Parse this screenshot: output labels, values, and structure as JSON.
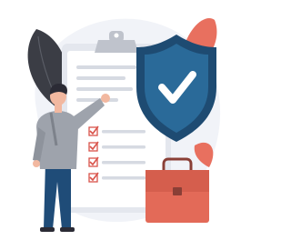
{
  "illustration": {
    "subject": "security-checklist",
    "icons": [
      "clipboard-icon",
      "shield-check-icon",
      "briefcase-icon",
      "checkbox-icon",
      "person-figure",
      "leaf-decoration"
    ],
    "checklist": {
      "checked_items": 4,
      "plain_lines": 4
    },
    "colors": {
      "background_blob": "#F1F3F8",
      "shield_outer": "#1E4B72",
      "shield_inner": "#2A6A99",
      "check": "#FFFFFF",
      "accent_coral": "#E8705F",
      "briefcase": "#E36A58",
      "leaf_dark": "#3B3D45",
      "clipboard_paper": "#FFFFFF",
      "clipboard_clip": "#BFC3CC",
      "line_gray": "#D6DAE2",
      "checkbox_red": "#D9534A",
      "sweater": "#9EA3AC",
      "jeans": "#1F4C78",
      "skin": "#F2B8A0",
      "hair": "#2B2B35"
    }
  }
}
